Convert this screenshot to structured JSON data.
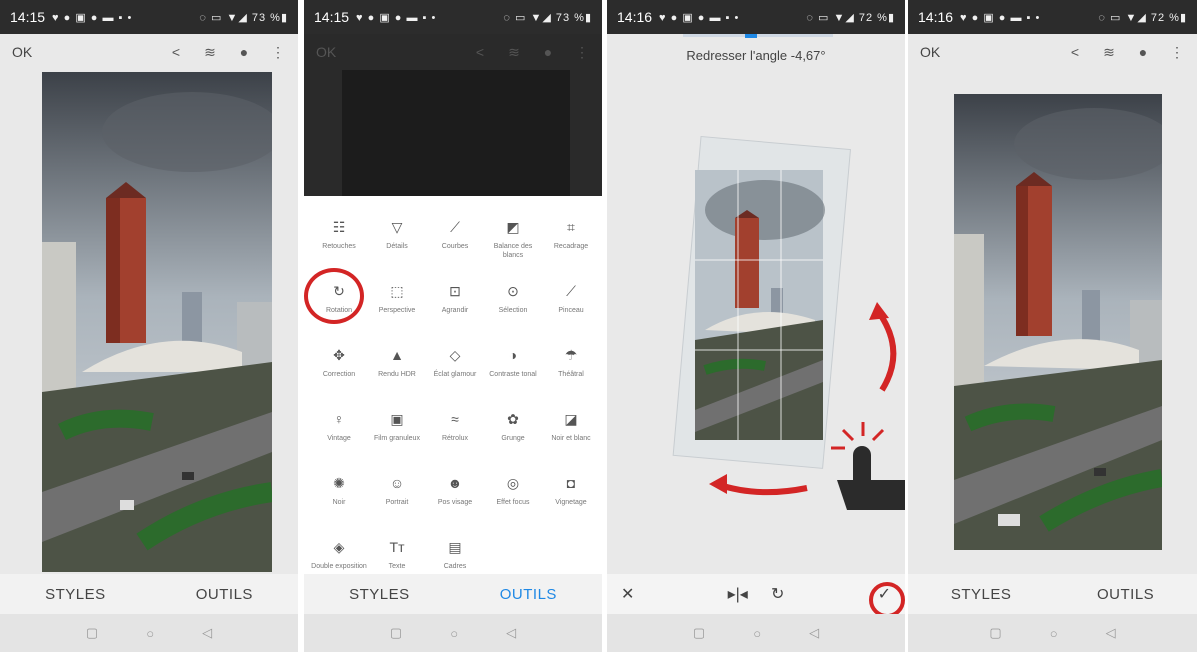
{
  "status": {
    "p1": {
      "time": "14:15",
      "icons": "♥ ● ▣ ● ▬ ▪ •",
      "right": "◌ ▭ ▼◢ 73 %▮"
    },
    "p2": {
      "time": "14:15",
      "icons": "♥ ● ▣ ● ▬ ▪ •",
      "right": "◌ ▭ ▼◢ 73 %▮"
    },
    "p3": {
      "time": "14:16",
      "icons": "♥ ● ▣ ● ▬ ▪ •",
      "right": "◌ ▭ ▼◢ 72 %▮"
    },
    "p4": {
      "time": "14:16",
      "icons": "♥ ● ▣ ● ▬ ▪ •",
      "right": "◌ ▭ ▼◢ 72 %▮"
    }
  },
  "topbar": {
    "ok": "OK"
  },
  "tabs": {
    "styles": "STYLES",
    "outils": "OUTILS"
  },
  "rotate": {
    "title": "Redresser l'angle -4,67°"
  },
  "nav": {
    "square": "▢",
    "circle": "○",
    "back": "◁"
  },
  "tools": [
    {
      "label": "Retouches",
      "glyph": "☷"
    },
    {
      "label": "Détails",
      "glyph": "▽"
    },
    {
      "label": "Courbes",
      "glyph": "⟋"
    },
    {
      "label": "Balance des blancs",
      "glyph": "◩"
    },
    {
      "label": "Recadrage",
      "glyph": "⌗"
    },
    {
      "label": "Rotation",
      "glyph": "↻"
    },
    {
      "label": "Perspective",
      "glyph": "⬚"
    },
    {
      "label": "Agrandir",
      "glyph": "⊡"
    },
    {
      "label": "Sélection",
      "glyph": "⊙"
    },
    {
      "label": "Pinceau",
      "glyph": "⟋"
    },
    {
      "label": "Correction",
      "glyph": "✥"
    },
    {
      "label": "Rendu HDR",
      "glyph": "▲"
    },
    {
      "label": "Éclat glamour",
      "glyph": "◇"
    },
    {
      "label": "Contraste tonal",
      "glyph": "◑"
    },
    {
      "label": "Théâtral",
      "glyph": "☂"
    },
    {
      "label": "Vintage",
      "glyph": "♀"
    },
    {
      "label": "Film granuleux",
      "glyph": "▣"
    },
    {
      "label": "Rétrolux",
      "glyph": "≈"
    },
    {
      "label": "Grunge",
      "glyph": "✿"
    },
    {
      "label": "Noir et blanc",
      "glyph": "◪"
    },
    {
      "label": "Noir",
      "glyph": "✺"
    },
    {
      "label": "Portrait",
      "glyph": "☺"
    },
    {
      "label": "Pos visage",
      "glyph": "☻"
    },
    {
      "label": "Effet focus",
      "glyph": "◎"
    },
    {
      "label": "Vignetage",
      "glyph": "◘"
    },
    {
      "label": "Double exposition",
      "glyph": "◈"
    },
    {
      "label": "Texte",
      "glyph": "Tт"
    },
    {
      "label": "Cadres",
      "glyph": "▤"
    }
  ],
  "icons": {
    "share": "share-icon",
    "filter": "filter-icon",
    "info": "info-icon",
    "more": "more-vert-icon",
    "close": "close-icon",
    "flip": "flip-icon",
    "rotate": "rotate-icon",
    "check": "check-icon"
  },
  "colors": {
    "accent": "#1e88e5",
    "highlight": "#d32525"
  }
}
